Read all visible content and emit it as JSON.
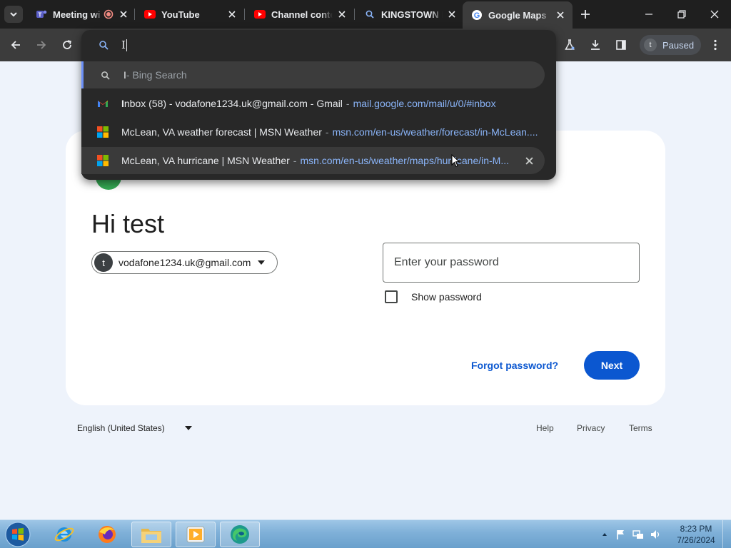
{
  "browser": {
    "tabs": [
      {
        "title": "Meeting wi",
        "icon": "teams-icon",
        "recording": true
      },
      {
        "title": "YouTube",
        "icon": "youtube-icon"
      },
      {
        "title": "Channel conte",
        "icon": "youtube-icon"
      },
      {
        "title": "KINGSTOWN H",
        "icon": "search-icon"
      },
      {
        "title": "Google Maps",
        "icon": "google-icon",
        "active": true
      }
    ],
    "profile_status": "Paused",
    "profile_initial": "t"
  },
  "omnibox": {
    "typed": "I",
    "suggestions": [
      {
        "highlight": "I",
        "rest": " - Bing Search",
        "icon": "search-icon",
        "selected": true
      },
      {
        "highlight": "I",
        "rest": "nbox (58) - vodafone1234.uk@gmail.com - Gmail",
        "url": "mail.google.com/mail/u/0/#inbox",
        "icon": "gmail-icon"
      },
      {
        "title": "McLean, VA weather forecast | MSN Weather",
        "url": "msn.com/en-us/weather/forecast/in-McLean....",
        "icon": "microsoft-icon"
      },
      {
        "title": "McLean, VA hurricane | MSN Weather",
        "url": "msn.com/en-us/weather/maps/hurricane/in-M...",
        "icon": "microsoft-icon",
        "hovered": true
      }
    ]
  },
  "signin": {
    "heading": "Hi test",
    "account_initial": "t",
    "account_email": "vodafone1234.uk@gmail.com",
    "password_placeholder": "Enter your password",
    "show_password_label": "Show password",
    "show_password_checked": false,
    "forgot_label": "Forgot password?",
    "next_label": "Next"
  },
  "footer": {
    "language": "English (United States)",
    "links": [
      "Help",
      "Privacy",
      "Terms"
    ]
  },
  "taskbar": {
    "apps": [
      "internet-explorer-icon",
      "firefox-icon",
      "file-explorer-icon",
      "media-player-icon",
      "edge-icon"
    ],
    "time": "8:23 PM",
    "date": "7/26/2024"
  },
  "colors": {
    "accent": "#0b57d0",
    "page_bg": "#eef3fb",
    "chrome_dark": "#1f1f1f",
    "link_blue": "#8ab4f8"
  }
}
